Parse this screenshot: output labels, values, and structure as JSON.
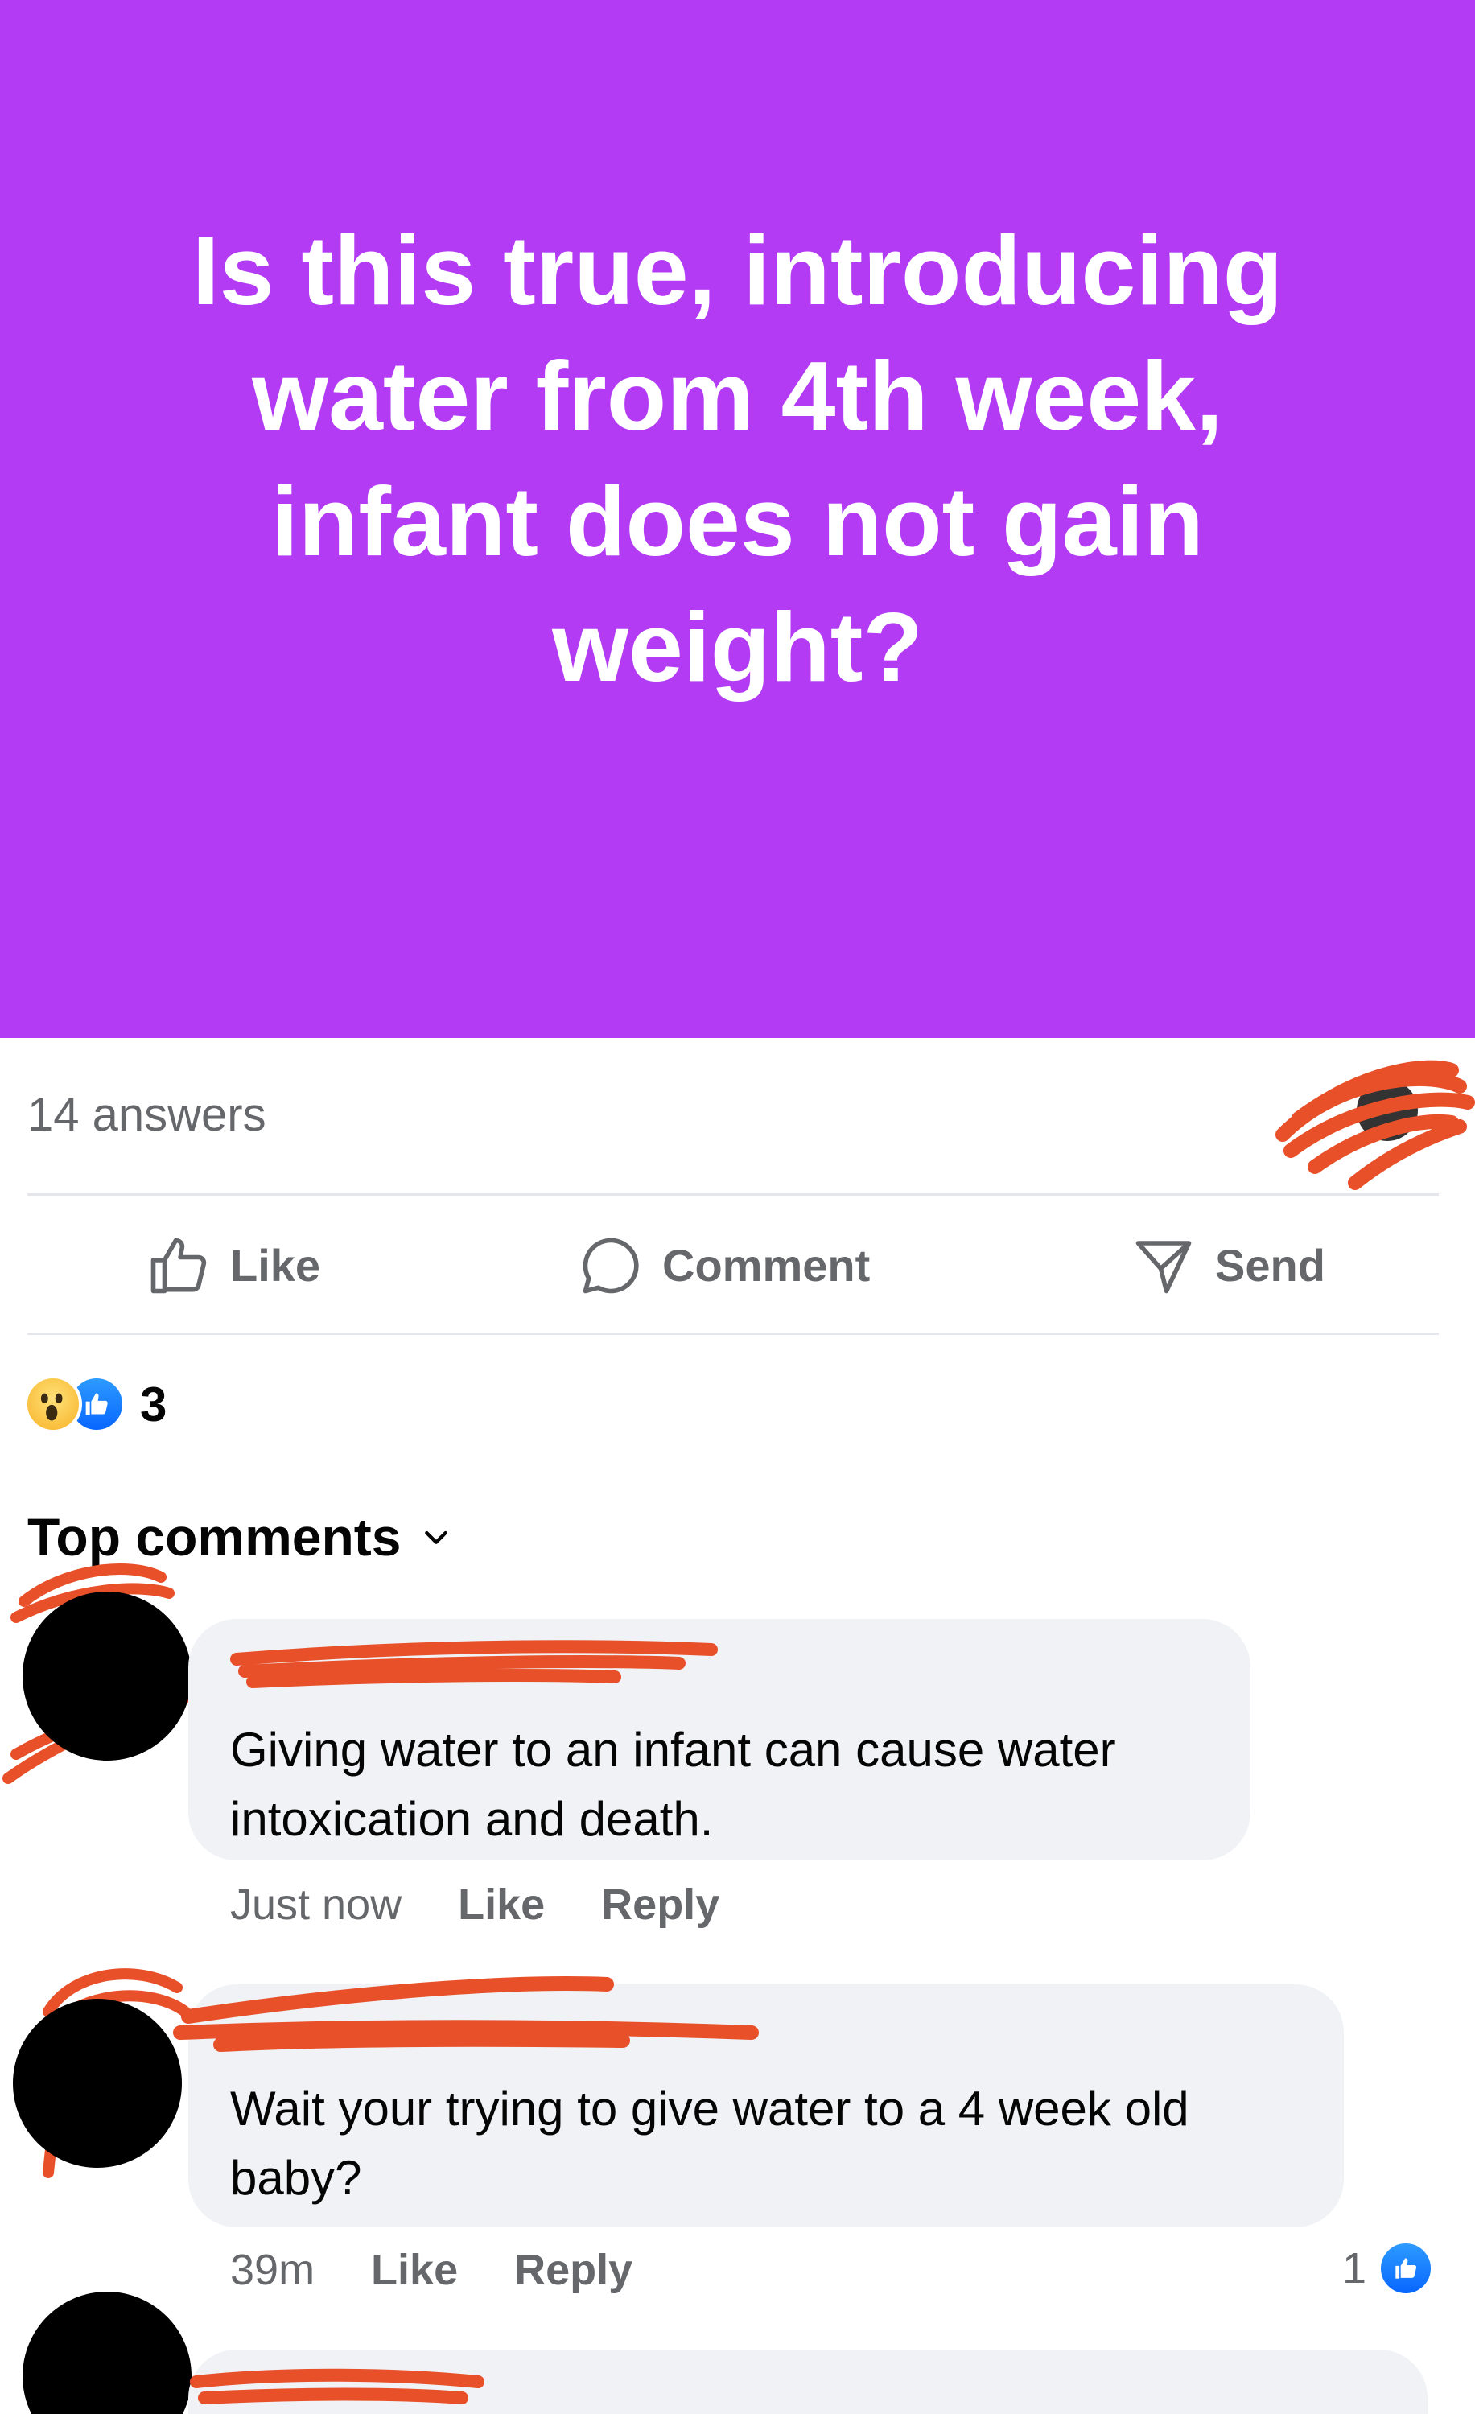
{
  "post": {
    "text": "Is this true, introducing water from 4th week, infant does not gain weight?",
    "background_color": "#b33bf3"
  },
  "stats": {
    "answers": "14 answers"
  },
  "actions": {
    "like_label": "Like",
    "comment_label": "Comment",
    "send_label": "Send"
  },
  "reactions": {
    "icons": [
      "wow-reaction-icon",
      "like-reaction-icon"
    ],
    "count": "3"
  },
  "comments_header": {
    "label": "Top comments",
    "icon": "chevron-down-icon"
  },
  "comments": [
    {
      "text": "Giving water to an infant can cause water intoxication and death.",
      "time": "Just now",
      "like_label": "Like",
      "reply_label": "Reply"
    },
    {
      "text": "Wait your trying to give water to a 4 week old baby?",
      "time": "39m",
      "like_label": "Like",
      "reply_label": "Reply",
      "like_count": "1"
    }
  ],
  "colors": {
    "redaction": "#e8502a",
    "secondary_text": "#65676b",
    "bubble": "#f0f2f5",
    "like_blue": "#0866ff"
  }
}
